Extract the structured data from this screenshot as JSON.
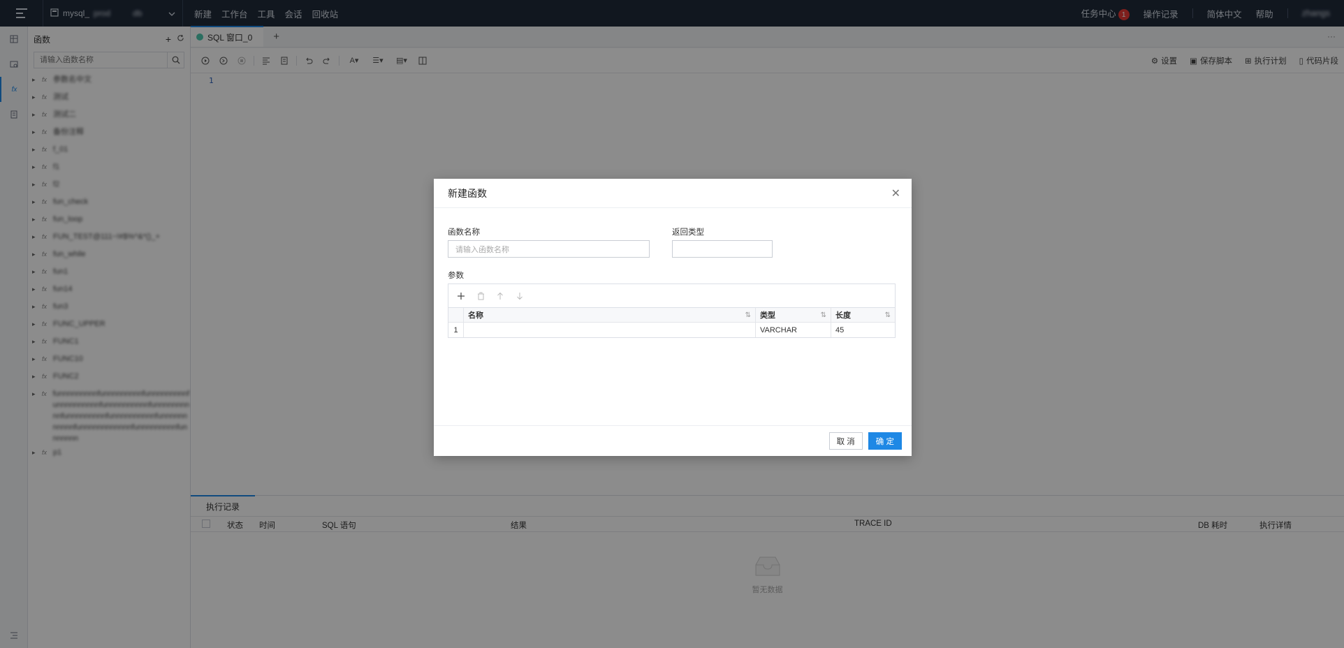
{
  "topbar": {
    "connection": "mysql_",
    "connection_suffix": "prod",
    "database": "db",
    "menu": [
      "新建",
      "工作台",
      "工具",
      "会话",
      "回收站"
    ],
    "task_center": "任务中心",
    "task_count": "1",
    "operation_log": "操作记录",
    "language": "简体中文",
    "help": "帮助",
    "user": "zhangs"
  },
  "fnpanel": {
    "title": "函数",
    "search_placeholder": "请输入函数名称",
    "items": [
      {
        "name": "参数名中文"
      },
      {
        "name": "测试"
      },
      {
        "name": "测试二"
      },
      {
        "name": "备份注释"
      },
      {
        "name": "f_01"
      },
      {
        "name": "f1"
      },
      {
        "name": "f2"
      },
      {
        "name": "fun_check"
      },
      {
        "name": "fun_loop"
      },
      {
        "name": "FUN_TEST@111~!#$%^&*()_+"
      },
      {
        "name": "fun_while"
      },
      {
        "name": "fun1"
      },
      {
        "name": "fun14"
      },
      {
        "name": "fun3"
      },
      {
        "name": "FUNC_UPPER"
      },
      {
        "name": "FUNC1"
      },
      {
        "name": "FUNC10"
      },
      {
        "name": "FUNC2"
      },
      {
        "name": "funnnnnnnnnfunnnnnnnnnfunnnnnnnnnfunnnnnnnnnnfunnnnnnnnnnfunnnnnnnnnnfunnnnnnnnnfunnnnnnnnnnfunnnnnnnnnnnfunnnnnnnnnnnnfunnnnnnnnnfunnnnnnn"
      },
      {
        "name": "p1"
      }
    ]
  },
  "editor": {
    "tab_label": "SQL 窗口_0",
    "line_number": "1",
    "toolbar_right": [
      "设置",
      "保存脚本",
      "执行计划",
      "代码片段"
    ]
  },
  "bottom": {
    "tab_label": "执行记录",
    "columns": [
      "状态",
      "时间",
      "SQL 语句",
      "结果",
      "TRACE ID",
      "DB 耗时",
      "执行详情"
    ],
    "empty_text": "暂无数据"
  },
  "modal": {
    "title": "新建函数",
    "name_label": "函数名称",
    "name_placeholder": "请输入函数名称",
    "return_type_label": "返回类型",
    "return_type_value": "",
    "params_label": "参数",
    "params_columns": [
      "名称",
      "类型",
      "长度"
    ],
    "params_rows": [
      {
        "index": "1",
        "name": "",
        "type": "VARCHAR",
        "length": "45"
      }
    ],
    "cancel": "取 消",
    "confirm": "确 定"
  },
  "colors": {
    "accent": "#1e88e5",
    "topbar_bg": "#1f2a3a",
    "badge": "#e53935"
  }
}
